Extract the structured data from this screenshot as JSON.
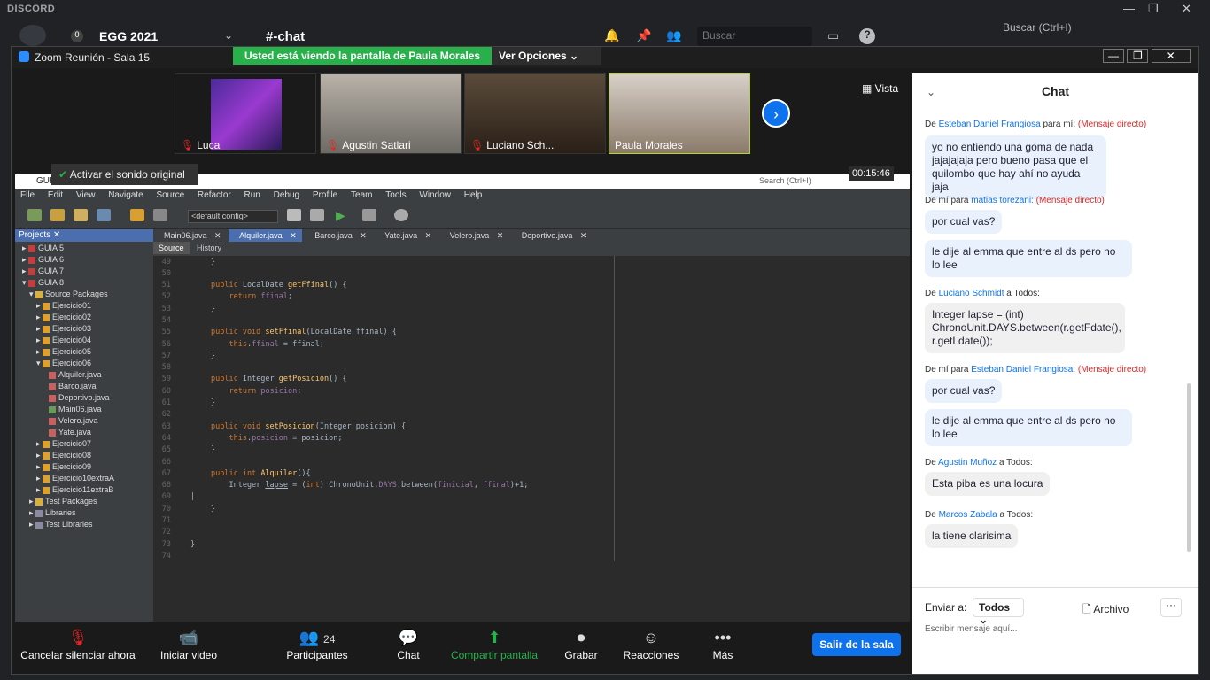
{
  "discord": {
    "logo": "DISCORD",
    "server": "EGG 2021",
    "channel": "#-chat",
    "search": "Buscar",
    "right_search": "Buscar (Ctrl+I)",
    "badge": "0"
  },
  "zoom": {
    "title": "Zoom Reunión - Sala 15",
    "banner": "Usted está viendo la pantalla de Paula Morales",
    "view_options": "Ver Opciones",
    "vista": "Vista",
    "audio": "Activar el sonido original",
    "timer": "00:15:46",
    "participants": [
      {
        "name": "Luca"
      },
      {
        "name": "Agustin Satlari"
      },
      {
        "name": "Luciano Sch..."
      },
      {
        "name": "Paula Morales"
      }
    ]
  },
  "netbeans": {
    "title": "GUIA 8 - NetBeans IDE 8.2",
    "search": "Search (Ctrl+I)",
    "config": "<default config>",
    "menu": [
      "File",
      "Edit",
      "View",
      "Navigate",
      "Source",
      "Refactor",
      "Run",
      "Debug",
      "Profile",
      "Team",
      "Tools",
      "Window",
      "Help"
    ],
    "projects_tab": "Projects",
    "tree": [
      "GUIA 5",
      "GUIA 6",
      "GUIA 7",
      "GUIA 8",
      "Source Packages",
      "Ejercicio01",
      "Ejercicio02",
      "Ejercicio03",
      "Ejercicio04",
      "Ejercicio05",
      "Ejercicio06",
      "Alquiler.java",
      "Barco.java",
      "Deportivo.java",
      "Main06.java",
      "Velero.java",
      "Yate.java",
      "Ejercicio07",
      "Ejercicio08",
      "Ejercicio09",
      "Ejercicio10extraA",
      "Ejercicio11extraB",
      "Test Packages",
      "Libraries",
      "Test Libraries"
    ],
    "tabs": [
      "Main06.java",
      "Alquiler.java",
      "Barco.java",
      "Yate.java",
      "Velero.java",
      "Deportivo.java"
    ],
    "source": "Source",
    "history": "History",
    "lines": [
      "49",
      "50",
      "51",
      "52",
      "53",
      "54",
      "55",
      "56",
      "57",
      "58",
      "59",
      "60",
      "61",
      "62",
      "63",
      "64",
      "65",
      "66",
      "67",
      "68",
      "69",
      "70",
      "71",
      "72",
      "73",
      "74"
    ]
  },
  "toolbar": {
    "mute": "Cancelar silenciar ahora",
    "video": "Iniciar video",
    "participants": "Participantes",
    "count": "24",
    "chat": "Chat",
    "share": "Compartir pantalla",
    "record": "Grabar",
    "reactions": "Reacciones",
    "more": "Más",
    "leave": "Salir de la sala"
  },
  "chat": {
    "title": "Chat",
    "send_to": "Enviar a:",
    "todos": "Todos",
    "archivo": "Archivo",
    "placeholder": "Escribir mensaje aquí...",
    "messages": [
      {
        "meta_pre": "De",
        "from": "Esteban Daniel Frangiosa",
        "meta_mid": "para mí:",
        "dm": "(Mensaje directo)",
        "text": "yo no entiendo una goma de nada jajajajaja pero bueno pasa que el quilombo que hay ahí no ayuda jaja"
      },
      {
        "meta_pre": "De mí para",
        "from": "matias torezani:",
        "dm": "(Mensaje directo)",
        "text1": "por cual vas?",
        "text2": "le dije al emma que entre al ds pero no lo lee"
      },
      {
        "meta_pre": "De",
        "from": "Luciano Schmidt",
        "meta_mid": "a Todos:",
        "text": "Integer lapse = (int) ChronoUnit.DAYS.between(r.getFdate(), r.getLdate());"
      },
      {
        "meta_pre": "De mí para",
        "from": "Esteban Daniel Frangiosa:",
        "dm": "(Mensaje directo)",
        "text1": "por cual vas?",
        "text2": "le dije al emma que entre al ds pero no lo lee"
      },
      {
        "meta_pre": "De",
        "from": "Agustin Muñoz",
        "meta_mid": "a Todos:",
        "text": "Esta piba es una locura"
      },
      {
        "meta_pre": "De",
        "from": "Marcos Zabala",
        "meta_mid": "a Todos:",
        "text": "la tiene clarisima"
      }
    ]
  }
}
